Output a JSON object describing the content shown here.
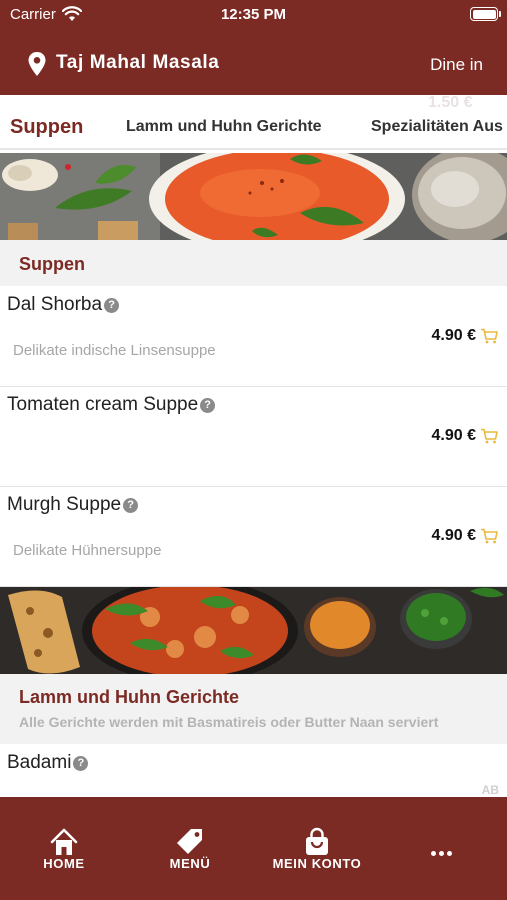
{
  "status_bar": {
    "carrier": "Carrier",
    "time": "12:35 PM"
  },
  "header": {
    "store_name": "Taj Mahal Masala",
    "order_mode": "Dine in"
  },
  "ghost_price": "1.50 €",
  "tabs": [
    {
      "label": "Suppen",
      "active": true
    },
    {
      "label": "Lamm und Huhn Gerichte",
      "active": false
    },
    {
      "label": "Spezialitäten Aus",
      "active": false
    }
  ],
  "sections": [
    {
      "title": "Suppen",
      "note": "",
      "banner": "tomato-soup-photo",
      "items": [
        {
          "name": "Dal Shorba",
          "description": "Delikate indische Linsensuppe",
          "price": "4.90 €"
        },
        {
          "name": "Tomaten cream Suppe",
          "description": "",
          "price": "4.90 €"
        },
        {
          "name": "Murgh Suppe",
          "description": "Delikate Hühnersuppe",
          "price": "4.90 €"
        }
      ]
    },
    {
      "title": "Lamm und Huhn Gerichte",
      "note": "Alle Gerichte werden mit Basmatireis oder Butter Naan serviert",
      "banner": "curry-naan-photo",
      "items": [
        {
          "name": "Badami",
          "description": "",
          "price": ""
        }
      ]
    }
  ],
  "badge_ab": "AB",
  "bottom_nav": [
    {
      "label": "HOME",
      "icon": "home-icon"
    },
    {
      "label": "MENÜ",
      "icon": "tag-icon"
    },
    {
      "label": "MEIN KONTO",
      "icon": "bag-icon"
    },
    {
      "label": "",
      "icon": "more-icon"
    }
  ],
  "colors": {
    "brand": "#7c2a24",
    "cart": "#e8b93b",
    "section_bg": "#f2f2f2"
  }
}
